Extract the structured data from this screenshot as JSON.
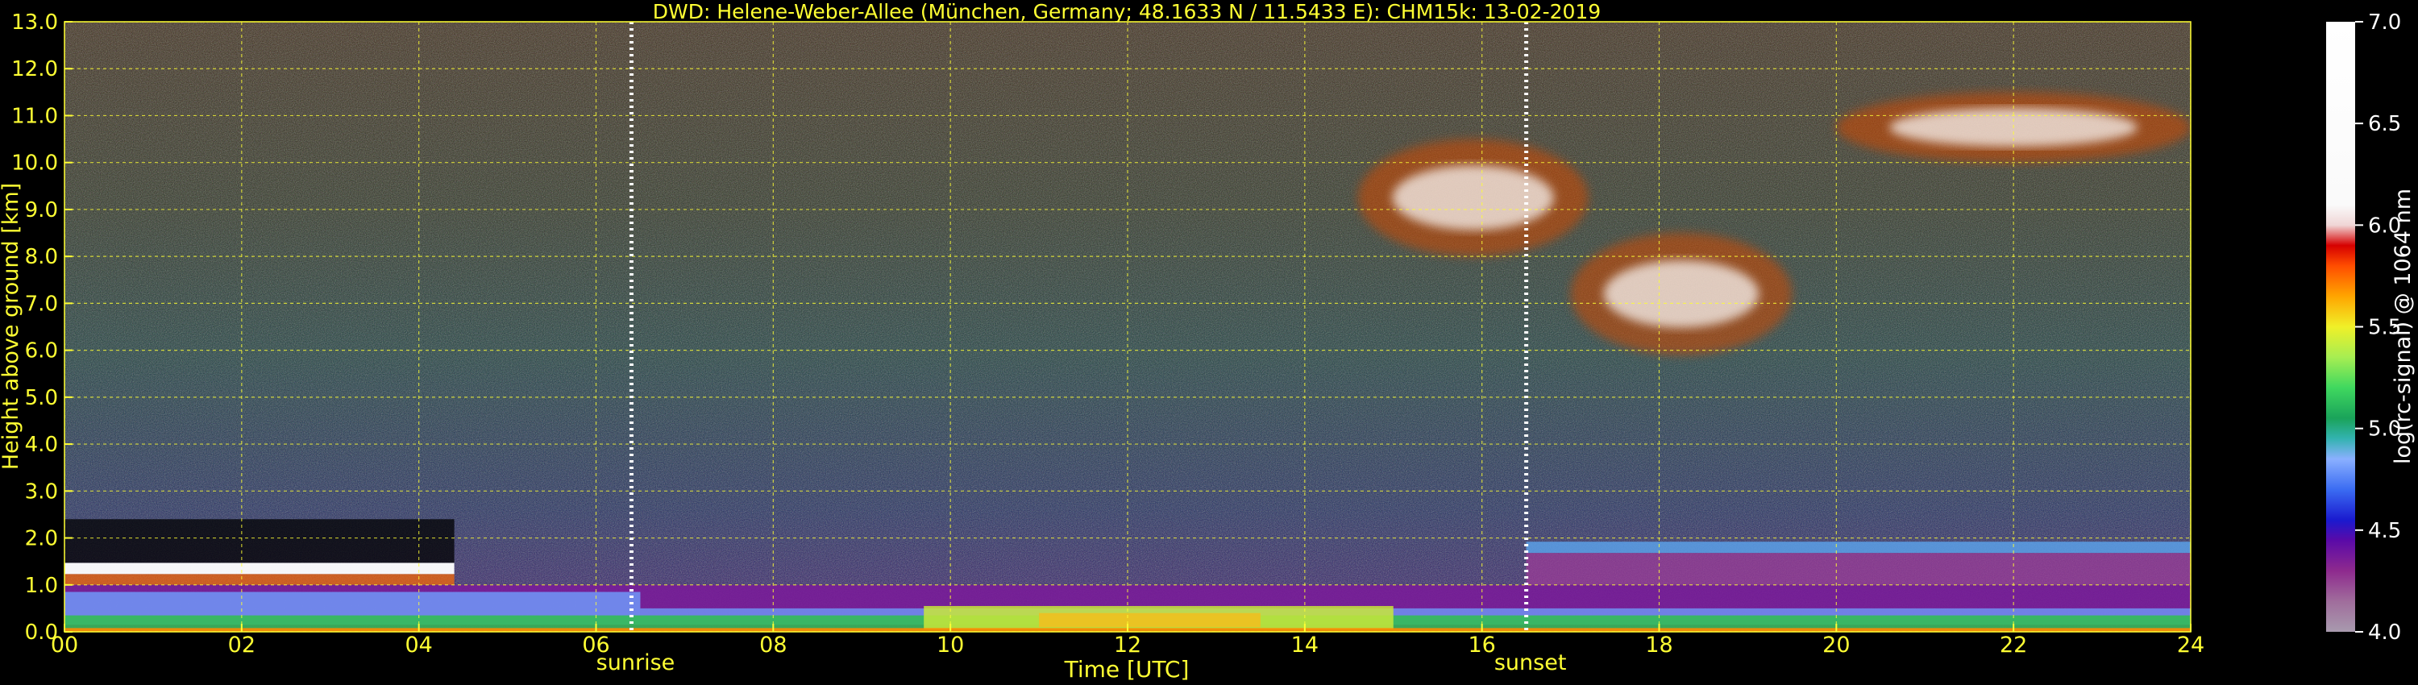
{
  "chart_data": {
    "type": "heatmap",
    "title": "DWD: Helene-Weber-Allee (München, Germany; 48.1633 N / 11.5433 E):    CHM15k: 13-02-2019",
    "xlabel": "Time [UTC]",
    "ylabel": "Height above ground [km]",
    "xlim": [
      0,
      24
    ],
    "ylim": [
      0,
      13
    ],
    "x_ticks": [
      "00",
      "02",
      "04",
      "06",
      "08",
      "10",
      "12",
      "14",
      "16",
      "18",
      "20",
      "22",
      "24"
    ],
    "y_ticks": [
      "0.0",
      "1.0",
      "2.0",
      "3.0",
      "4.0",
      "5.0",
      "6.0",
      "7.0",
      "8.0",
      "9.0",
      "10.0",
      "11.0",
      "12.0",
      "13.0"
    ],
    "grid": true,
    "events": [
      {
        "label": "sunrise",
        "time": 6.4
      },
      {
        "label": "sunset",
        "time": 16.5
      }
    ],
    "colorbar": {
      "label": "log(rc-signal) @ 1064 nm",
      "range": [
        4.0,
        7.0
      ],
      "ticks": [
        "4.0",
        "4.5",
        "5.0",
        "5.5",
        "6.0",
        "6.5",
        "7.0"
      ],
      "stops": [
        {
          "value": 4.0,
          "color": "#a89aae"
        },
        {
          "value": 4.15,
          "color": "#a06d9c"
        },
        {
          "value": 4.3,
          "color": "#8e2a8e"
        },
        {
          "value": 4.45,
          "color": "#5a0aa8"
        },
        {
          "value": 4.55,
          "color": "#1a1acf"
        },
        {
          "value": 4.7,
          "color": "#3b6cf2"
        },
        {
          "value": 4.85,
          "color": "#8ab0ff"
        },
        {
          "value": 4.95,
          "color": "#33b3b0"
        },
        {
          "value": 5.05,
          "color": "#1aa35a"
        },
        {
          "value": 5.2,
          "color": "#3fd85f"
        },
        {
          "value": 5.35,
          "color": "#a6ee52"
        },
        {
          "value": 5.5,
          "color": "#f0f028"
        },
        {
          "value": 5.65,
          "color": "#ffa500"
        },
        {
          "value": 5.8,
          "color": "#ff4d00"
        },
        {
          "value": 5.9,
          "color": "#d60000"
        },
        {
          "value": 6.0,
          "color": "#f0d6d6"
        },
        {
          "value": 6.1,
          "color": "#fafafa"
        },
        {
          "value": 7.0,
          "color": "#ffffff"
        }
      ]
    },
    "features": [
      {
        "name": "low cloud layer",
        "t_start": 0.0,
        "t_end": 4.4,
        "height_km": 1.35
      },
      {
        "name": "boundary layer",
        "t_start": 0.0,
        "t_end": 24.0,
        "height_km": [
          0.0,
          1.0
        ]
      },
      {
        "name": "residual aerosol layer",
        "t_start": 16.5,
        "t_end": 24.0,
        "height_km": 1.8
      },
      {
        "name": "cirrus",
        "t_start": 14.6,
        "t_end": 17.2,
        "height_km": [
          8.0,
          10.5
        ]
      },
      {
        "name": "mid-level cloud",
        "t_start": 17.0,
        "t_end": 19.5,
        "height_km": [
          5.9,
          8.5
        ]
      },
      {
        "name": "high cirrus",
        "t_start": 20.0,
        "t_end": 24.0,
        "height_km": [
          10.0,
          11.5
        ]
      }
    ]
  }
}
